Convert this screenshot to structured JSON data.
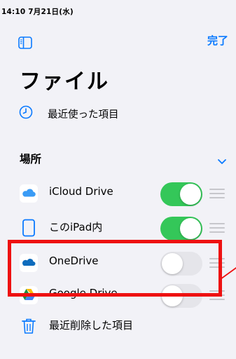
{
  "status_bar": {
    "time": "14:10",
    "date": "7月21日(水)"
  },
  "nav": {
    "sidebar_icon": "sidebar-icon",
    "done_label": "完了",
    "accent_color": "#0a7aff"
  },
  "title": "ファイル",
  "recent": {
    "icon": "clock-icon",
    "label": "最近使った項目"
  },
  "locations": {
    "header": "場所",
    "chevron_icon": "chevron-down-icon",
    "items": [
      {
        "label": "iCloud Drive",
        "icon": "icloud-icon",
        "enabled": true
      },
      {
        "label": "このiPad内",
        "icon": "ipad-icon",
        "enabled": true
      },
      {
        "label": "OneDrive",
        "icon": "onedrive-icon",
        "enabled": false
      },
      {
        "label": "Google Drive",
        "icon": "google-drive-icon",
        "enabled": false
      }
    ],
    "trash": {
      "label": "最近削除した項目",
      "icon": "trash-icon"
    }
  },
  "colors": {
    "toggle_on": "#34c759",
    "toggle_off": "#e5e5ea",
    "highlight": "#ee1111",
    "background": "#f2f2f7"
  }
}
